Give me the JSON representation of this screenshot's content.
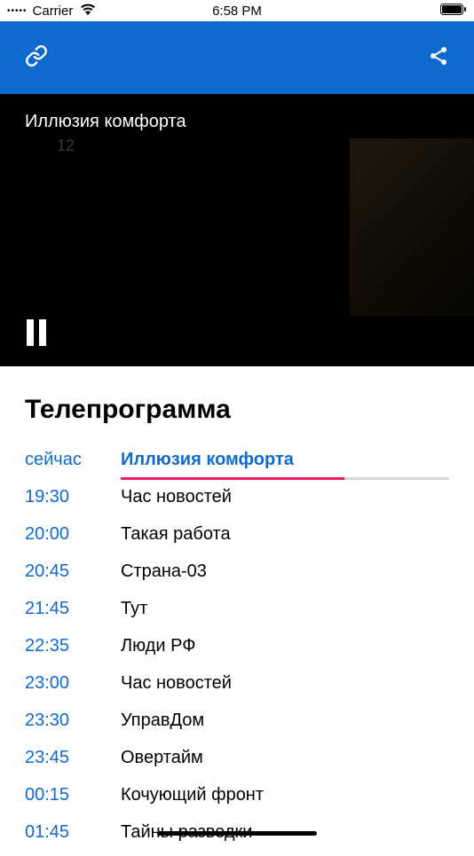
{
  "statusBar": {
    "carrier": "Carrier",
    "time": "6:58 PM"
  },
  "video": {
    "title": "Иллюзия комфорта",
    "watermark": "12"
  },
  "sectionTitle": "Телепрограмма",
  "schedule": {
    "nowLabel": "сейчас",
    "current": {
      "title": "Иллюзия комфорта",
      "progressPercent": 68
    },
    "items": [
      {
        "time": "19:30",
        "title": "Час новостей"
      },
      {
        "time": "20:00",
        "title": "Такая работа"
      },
      {
        "time": "20:45",
        "title": "Страна-03"
      },
      {
        "time": "21:45",
        "title": "Тут"
      },
      {
        "time": "22:35",
        "title": "Люди РФ"
      },
      {
        "time": "23:00",
        "title": "Час новостей"
      },
      {
        "time": "23:30",
        "title": "УправДом"
      },
      {
        "time": "23:45",
        "title": "Овертайм"
      },
      {
        "time": "00:15",
        "title": "Кочующий фронт"
      },
      {
        "time": "01:45",
        "title": "Тайны разведки"
      }
    ]
  }
}
